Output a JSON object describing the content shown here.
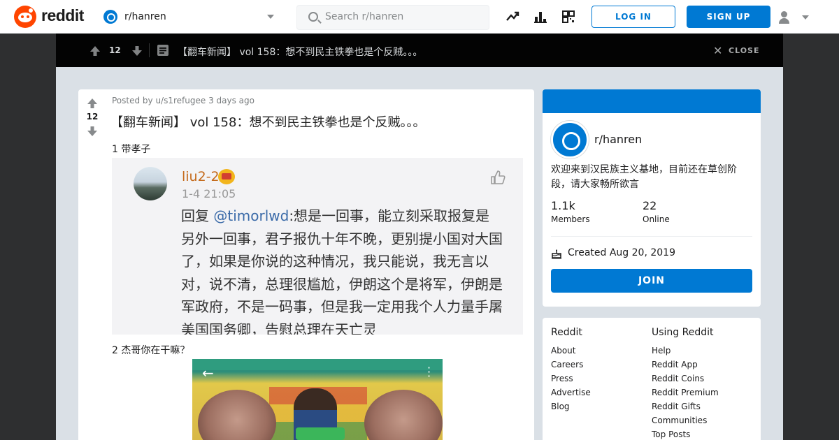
{
  "header": {
    "wordmark": "reddit",
    "subreddit": "r/hanren",
    "search_placeholder": "Search r/hanren",
    "icons": [
      "trending-icon",
      "stats-icon",
      "coins-icon"
    ],
    "login_label": "LOG IN",
    "signup_label": "SIGN UP"
  },
  "topbar": {
    "score": "12",
    "title": "【翻车新闻】 vol 158：想不到民主铁拳也是个反贼。。。",
    "close_label": "CLOSE"
  },
  "post": {
    "score": "12",
    "byline": "Posted by u/s1refugee 3 days ago",
    "title": "【翻车新闻】 vol 158：想不到民主铁拳也是个反贼。。。",
    "para1": "1 带孝子",
    "para2": "2 杰哥你在干嘛？",
    "embedded_comment": {
      "username": "liu2-2",
      "time": "1-4 21:05",
      "reply_prefix": "回复 ",
      "mention": "@timorlwd",
      "reply_text": ":想是一回事，能立刻采取报复是另外一回事，君子报仇十年不晚，更别提小国对大国了，如果是你说的这种情况，我只能说，我无言以对，说不清，总理很尴尬，伊朗这个是将军，伊朗是军政府，不是一码事，但是我一定用我个人力量手屠美国国务卿，告慰总理在天亡灵"
    }
  },
  "community": {
    "name": "r/hanren",
    "description": "欢迎来到汉民族主义基地，目前还在草创阶段，请大家畅所欲言",
    "members_value": "1.1k",
    "members_label": "Members",
    "online_value": "22",
    "online_label": "Online",
    "created": "Created Aug 20, 2019",
    "join_label": "JOIN"
  },
  "links": {
    "col1_title": "Reddit",
    "col1": [
      "About",
      "Careers",
      "Press",
      "Advertise",
      "Blog"
    ],
    "col2_title": "Using Reddit",
    "col2": [
      "Help",
      "Reddit App",
      "Reddit Coins",
      "Reddit Premium",
      "Reddit Gifts",
      "Communities",
      "Top Posts"
    ]
  },
  "colors": {
    "brand": "#ff4500",
    "accent": "#0079d3",
    "topbar": "#030303",
    "backdrop": "#dae0e6"
  }
}
